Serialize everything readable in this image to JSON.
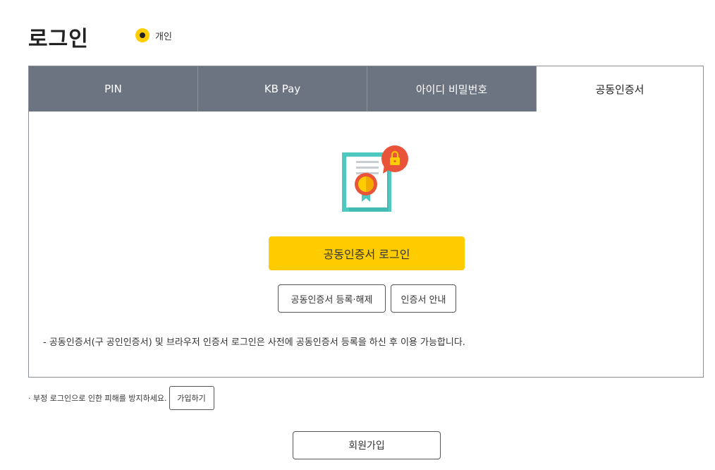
{
  "header": {
    "title": "로그인",
    "user_type_label": "개인"
  },
  "tabs": [
    {
      "label": "PIN"
    },
    {
      "label": "KB Pay"
    },
    {
      "label": "아이디 비밀번호"
    },
    {
      "label": "공동인증서"
    }
  ],
  "cert_panel": {
    "icon": "certificate-lock-icon",
    "login_button": "공동인증서 로그인",
    "register_button": "공동인증서 등록·해제",
    "guide_button": "인증서 안내",
    "notice": "- 공동인증서(구 공인인증서) 및 브라우저 인증서 로그인은 사전에 공동인증서 등록을 하신 후 이용 가능합니다."
  },
  "footer": {
    "warning": "· 부정 로그인으로 인한 피해를 방지하세요.",
    "join_small_button": "가입하기",
    "signup_button": "회원가입"
  },
  "colors": {
    "accent": "#ffcc00",
    "tab_inactive": "#6b7480",
    "cert_teal": "#4ec9c0",
    "lock_red": "#e8533a"
  }
}
